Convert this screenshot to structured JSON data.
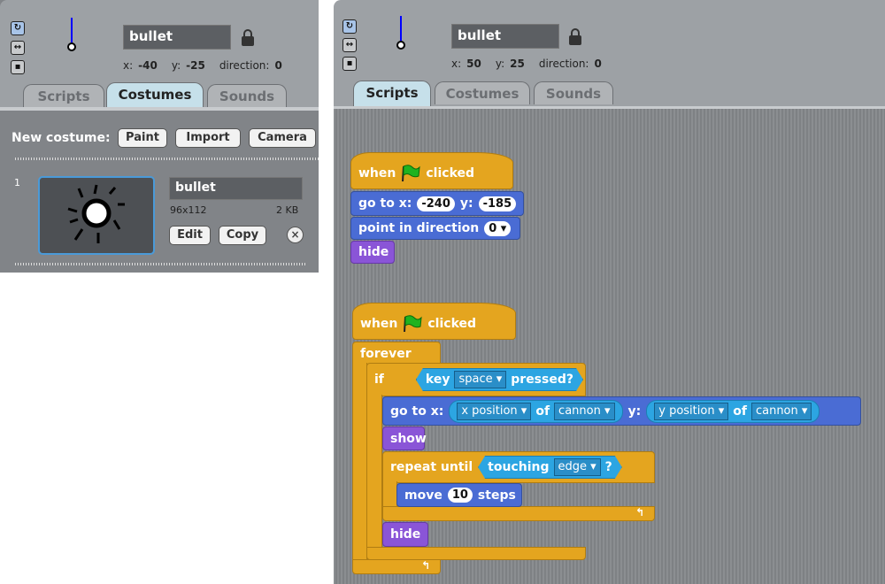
{
  "left": {
    "sprite_name": "bullet",
    "x_label": "x:",
    "x": "-40",
    "y_label": "y:",
    "y": "-25",
    "direction_label": "direction:",
    "direction": "0",
    "tabs": [
      {
        "label": "Scripts"
      },
      {
        "label": "Costumes",
        "active": true
      },
      {
        "label": "Sounds"
      }
    ],
    "new_costume_label": "New costume:",
    "paint": "Paint",
    "import": "Import",
    "camera": "Camera",
    "costume": {
      "index": "1",
      "name": "bullet",
      "size": "96x112",
      "filesize": "2 KB",
      "edit": "Edit",
      "copy": "Copy"
    }
  },
  "right": {
    "sprite_name": "bullet",
    "x_label": "x:",
    "x": "50",
    "y_label": "y:",
    "y": "25",
    "direction_label": "direction:",
    "direction": "0",
    "tabs": [
      {
        "label": "Scripts",
        "active": true
      },
      {
        "label": "Costumes"
      },
      {
        "label": "Sounds"
      }
    ]
  },
  "script1": {
    "when": "when",
    "clicked": "clicked",
    "goto": "go to x:",
    "gx": "-240",
    "gy_label": "y:",
    "gy": "-185",
    "point": "point in direction",
    "dir": "0",
    "hide": "hide"
  },
  "script2": {
    "when": "when",
    "clicked": "clicked",
    "forever": "forever",
    "if": "if",
    "key": "key",
    "space": "space",
    "pressed": "pressed?",
    "goto": "go to x:",
    "xpos": "x position",
    "of": "of",
    "cannon": "cannon",
    "y_label": "y:",
    "ypos": "y position",
    "show": "show",
    "repeat": "repeat until",
    "touching": "touching",
    "edge": "edge",
    "q": "?",
    "move": "move",
    "steps_val": "10",
    "steps": "steps",
    "hide": "hide"
  },
  "colors": {
    "control": "#e4a51f",
    "motion": "#4a6cd4",
    "looks": "#8a55d7",
    "sensing": "#2ca5e2"
  }
}
